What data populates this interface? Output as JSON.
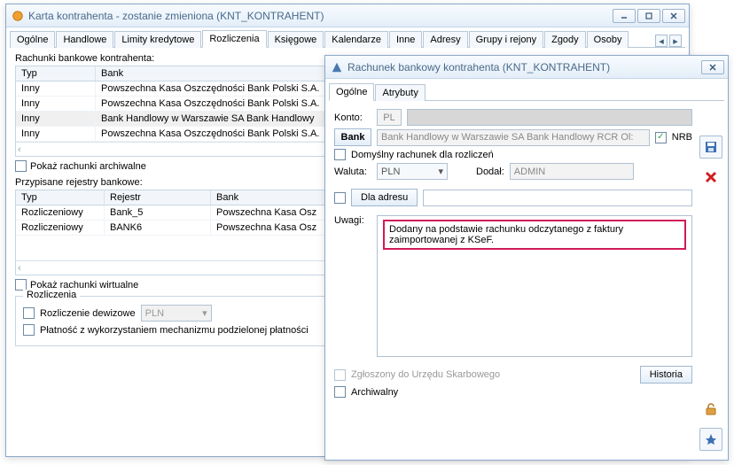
{
  "win1": {
    "title": "Karta kontrahenta - zostanie zmieniona (KNT_KONTRAHENT)",
    "tabs": [
      "Ogólne",
      "Handlowe",
      "Limity kredytowe",
      "Rozliczenia",
      "Księgowe",
      "Kalendarze",
      "Inne",
      "Adresy",
      "Grupy i rejony",
      "Zgody",
      "Osoby"
    ],
    "active_tab": 3,
    "section1_label": "Rachunki bankowe kontrahenta:",
    "grid1": {
      "cols": [
        "Typ",
        "Bank"
      ],
      "rows": [
        [
          "Inny",
          "Powszechna Kasa Oszczędności Bank Polski S.A."
        ],
        [
          "Inny",
          "Powszechna Kasa Oszczędności Bank Polski S.A."
        ],
        [
          "Inny",
          "Bank Handlowy w Warszawie SA Bank Handlowy"
        ],
        [
          "Inny",
          "Powszechna Kasa Oszczędności Bank Polski S.A."
        ]
      ],
      "selected": 2
    },
    "archival_chk": "Pokaż rachunki archiwalne",
    "section2_label": "Przypisane rejestry bankowe:",
    "grid2": {
      "cols": [
        "Typ",
        "Rejestr",
        "Bank"
      ],
      "rows": [
        [
          "Rozliczeniowy",
          "Bank_5",
          "Powszechna Kasa Osz"
        ],
        [
          "Rozliczeniowy",
          "BANK6",
          "Powszechna Kasa Osz"
        ]
      ]
    },
    "virtual_chk": "Pokaż rachunki wirtualne",
    "fieldset_label": "Rozliczenia",
    "fx_chk": "Rozliczenie dewizowe",
    "fx_currency": "PLN",
    "split_chk": "Płatność z wykorzystaniem mechanizmu podzielonej płatności"
  },
  "win2": {
    "title": "Rachunek bankowy kontrahenta (KNT_KONTRAHENT)",
    "tabs": [
      "Ogólne",
      "Atrybuty"
    ],
    "active_tab": 0,
    "konto_label": "Konto:",
    "konto_prefix": "PL",
    "bank_btn": "Bank",
    "bank_value": "Bank Handlowy w Warszawie SA Bank Handlowy RCR Ol:",
    "nrb_chk": "NRB",
    "nrb_checked": true,
    "default_chk": "Domyślny rachunek dla rozliczeń",
    "waluta_label": "Waluta:",
    "waluta_value": "PLN",
    "dodal_label": "Dodał:",
    "dodal_value": "ADMIN",
    "dla_adresu_btn": "Dla adresu",
    "uwagi_label": "Uwagi:",
    "uwagi_text": "Dodany na podstawie rachunku odczytanego z faktury zaimportowanej z KSeF.",
    "zgloszony_chk": "Zgłoszony do Urzędu Skarbowego",
    "historia_btn": "Historia",
    "archiwalny_chk": "Archiwalny"
  }
}
